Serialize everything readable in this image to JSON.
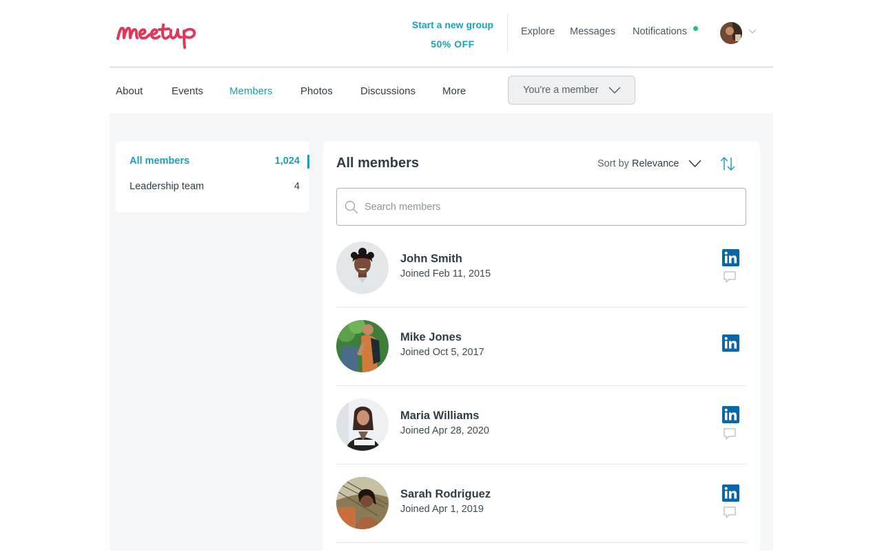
{
  "brand": {
    "logo_text": "Meetup",
    "accent": "#1aa0b8",
    "logo_color": "#e0385a"
  },
  "header": {
    "promo_line1": "Start a new group",
    "promo_line2": "50% OFF",
    "nav": [
      "Explore",
      "Messages",
      "Notifications"
    ],
    "notification_dot_color": "#19c47d"
  },
  "tabs": [
    {
      "label": "About",
      "active": false
    },
    {
      "label": "Events",
      "active": false
    },
    {
      "label": "Members",
      "active": true
    },
    {
      "label": "Photos",
      "active": false
    },
    {
      "label": "Discussions",
      "active": false
    },
    {
      "label": "More",
      "active": false
    }
  ],
  "membership_button": "You're a member",
  "sidebar": {
    "items": [
      {
        "label": "All members",
        "count": "1,024",
        "active": true
      },
      {
        "label": "Leadership team",
        "count": "4",
        "active": false
      }
    ]
  },
  "main": {
    "title": "All members",
    "sort_prefix": "Sort by",
    "sort_value": "Relevance",
    "search_placeholder": "Search members",
    "members": [
      {
        "name": "John Smith",
        "joined": "Joined Feb 11, 2015",
        "linkedin": true,
        "message": true
      },
      {
        "name": "Mike Jones",
        "joined": "Joined Oct 5, 2017",
        "linkedin": true,
        "message": false
      },
      {
        "name": "Maria Williams",
        "joined": "Joined Apr 28, 2020",
        "linkedin": true,
        "message": true
      },
      {
        "name": "Sarah Rodriguez",
        "joined": "Joined Apr 1, 2019",
        "linkedin": true,
        "message": true
      }
    ]
  },
  "icons": [
    "meetup-logo",
    "chevron-down-icon",
    "search-icon",
    "sort-arrows-icon",
    "linkedin-icon",
    "message-bubble-icon"
  ]
}
